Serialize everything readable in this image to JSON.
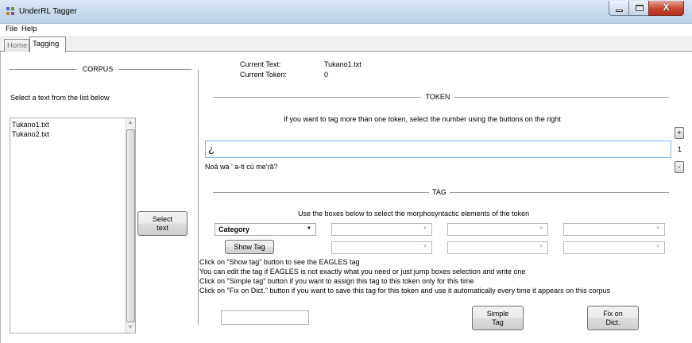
{
  "window": {
    "title": "UnderRL Tagger",
    "close_glyph": "X"
  },
  "menu": [
    "File",
    "Help"
  ],
  "tabs": [
    "Home",
    "Tagging"
  ],
  "corpus": {
    "header": "CORPUS",
    "instruction": "Select a text from the list below",
    "files": [
      "Tukano1.txt",
      "Tukano2.txt"
    ],
    "select_button": "Select\ntext"
  },
  "status": {
    "current_text_label": "Current Text:",
    "current_text_value": "Tukano1.txt",
    "current_token_label": "Current Token:",
    "current_token_value": "0"
  },
  "token": {
    "header": "TOKEN",
    "instruction": "If you want to tag more than one token, select the number using the buttons on the right",
    "value": "¿",
    "sentence": "Noá wa ' a-ti cü me'rã?",
    "plus": "+",
    "count": "1",
    "minus": "-"
  },
  "tag": {
    "header": "TAG",
    "instruction": "Use the boxes below to select the morphosyntactic elements of the token",
    "category": "Category",
    "show_tag_button": "Show Tag",
    "help_lines": [
      "Click on \"Show tag\" button to see the EAGLES tag",
      "You can edit the tag if EAGLES is not exactly what you need or just jump boxes selection and write one",
      "Click on \"Simple tag\" button if you want to assign this tag to this token only for this time",
      "Click on \"Fix on Dict.\" button if you want to save this tag for this token and use it automatically every time it appears on this corpus"
    ],
    "simple_tag_button": "Simple\nTag",
    "fix_dict_button": "Fix on\nDict."
  },
  "icons": {
    "app": "app-tag-icon",
    "dropdown": "chevron-down-icon"
  }
}
